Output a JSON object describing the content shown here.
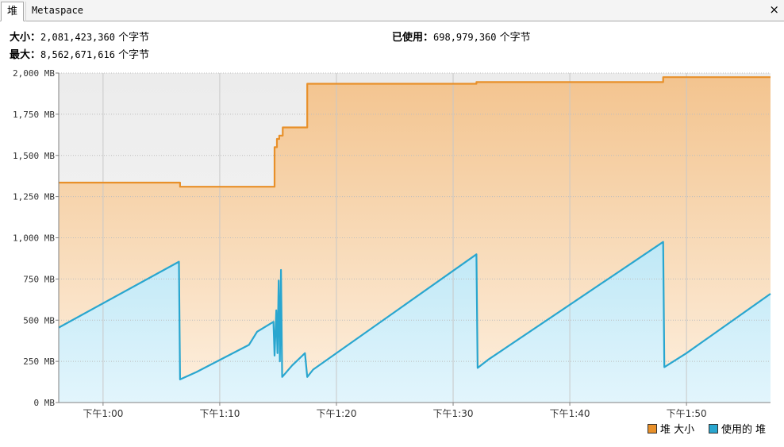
{
  "tabs": [
    {
      "label": "堆",
      "active": true
    },
    {
      "label": "Metaspace",
      "active": false
    }
  ],
  "close_icon": "×",
  "summary": {
    "size_label": "大小：",
    "size_value": "2,081,423,360",
    "size_unit": "个字节",
    "max_label": "最大：",
    "max_value": "8,562,671,616",
    "max_unit": "个字节",
    "used_label": "已使用：",
    "used_value": "698,979,360",
    "used_unit": "个字节"
  },
  "chart_data": {
    "type": "area",
    "x_unit": "minutes after 下午12:00",
    "xlim": [
      56.2,
      117.2
    ],
    "ylim": [
      0,
      2000
    ],
    "y_ticks": [
      {
        "value": 0,
        "label": "0 MB"
      },
      {
        "value": 250,
        "label": "250 MB"
      },
      {
        "value": 500,
        "label": "500 MB"
      },
      {
        "value": 750,
        "label": "750 MB"
      },
      {
        "value": 1000,
        "label": "1,000 MB"
      },
      {
        "value": 1250,
        "label": "1,250 MB"
      },
      {
        "value": 1500,
        "label": "1,500 MB"
      },
      {
        "value": 1750,
        "label": "1,750 MB"
      },
      {
        "value": 2000,
        "label": "2,000 MB"
      }
    ],
    "x_ticks": [
      {
        "value": 60,
        "label": "下午1:00"
      },
      {
        "value": 70,
        "label": "下午1:10"
      },
      {
        "value": 80,
        "label": "下午1:20"
      },
      {
        "value": 90,
        "label": "下午1:30"
      },
      {
        "value": 100,
        "label": "下午1:40"
      },
      {
        "value": 110,
        "label": "下午1:50"
      }
    ],
    "grid": true,
    "legend_position": "bottom-right",
    "series": [
      {
        "name": "堆 大小",
        "color": "#e8902a",
        "points": [
          [
            56.2,
            1335
          ],
          [
            66.6,
            1335
          ],
          [
            66.6,
            1310
          ],
          [
            74.7,
            1310
          ],
          [
            74.7,
            1550
          ],
          [
            74.9,
            1550
          ],
          [
            74.9,
            1600
          ],
          [
            75.1,
            1600
          ],
          [
            75.1,
            1620
          ],
          [
            75.4,
            1620
          ],
          [
            75.4,
            1670
          ],
          [
            77.5,
            1670
          ],
          [
            77.5,
            1935
          ],
          [
            92.0,
            1935
          ],
          [
            92.0,
            1945
          ],
          [
            108.0,
            1945
          ],
          [
            108.0,
            1975
          ],
          [
            117.2,
            1975
          ]
        ]
      },
      {
        "name": "使用的 堆",
        "color": "#29a6cf",
        "points": [
          [
            56.2,
            455
          ],
          [
            66.5,
            855
          ],
          [
            66.6,
            140
          ],
          [
            68.0,
            185
          ],
          [
            72.5,
            350
          ],
          [
            73.2,
            430
          ],
          [
            74.6,
            490
          ],
          [
            74.7,
            285
          ],
          [
            74.85,
            560
          ],
          [
            74.95,
            300
          ],
          [
            75.05,
            740
          ],
          [
            75.15,
            250
          ],
          [
            75.25,
            805
          ],
          [
            75.35,
            155
          ],
          [
            76.2,
            225
          ],
          [
            77.3,
            300
          ],
          [
            77.4,
            230
          ],
          [
            77.5,
            155
          ],
          [
            78.0,
            200
          ],
          [
            92.0,
            900
          ],
          [
            92.1,
            210
          ],
          [
            93.0,
            260
          ],
          [
            108.0,
            975
          ],
          [
            108.1,
            215
          ],
          [
            110.0,
            300
          ],
          [
            117.2,
            660
          ]
        ]
      }
    ]
  }
}
